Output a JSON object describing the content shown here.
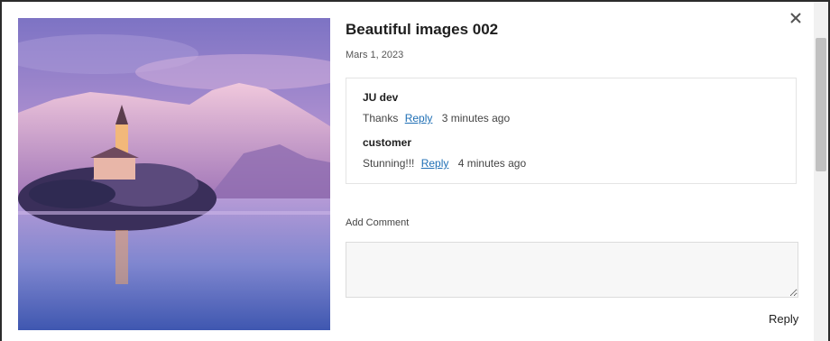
{
  "post": {
    "title": "Beautiful images 002",
    "date": "Mars 1, 2023",
    "image_alt_icon": "landscape-photo"
  },
  "comments": [
    {
      "author": "JU dev",
      "text": "Thanks",
      "reply_label": "Reply",
      "time": "3 minutes ago"
    },
    {
      "author": "customer",
      "text": "Stunning!!!",
      "reply_label": "Reply",
      "time": "4 minutes ago"
    }
  ],
  "add_comment": {
    "label": "Add Comment",
    "value": "",
    "submit_label": "Reply"
  },
  "icons": {
    "close": "close-icon"
  },
  "colors": {
    "link": "#1f6fb5",
    "backdrop": "#2b2b2b"
  }
}
